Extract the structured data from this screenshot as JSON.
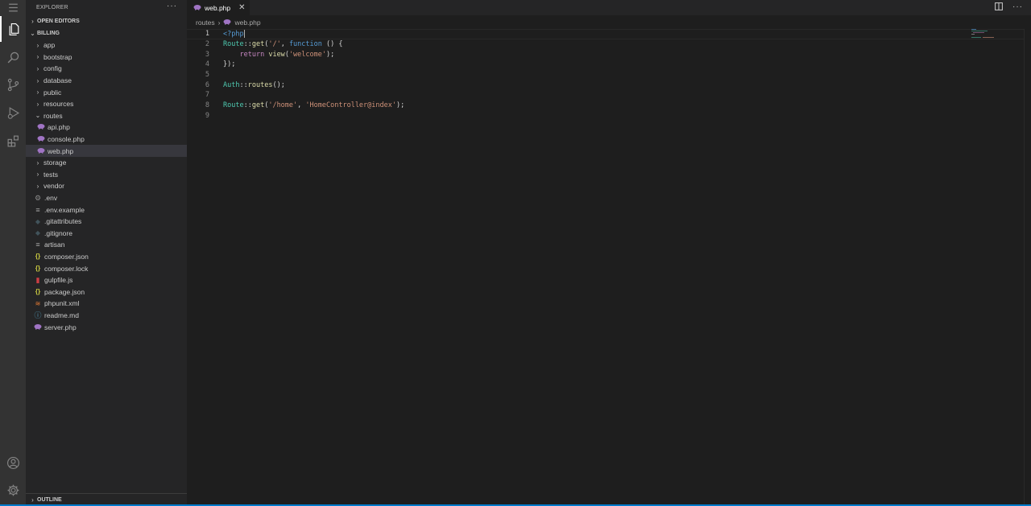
{
  "colors": {
    "php_icon": "#a074c4",
    "json_icon": "#cbcb41",
    "gulp_icon": "#cc3e44",
    "xml_icon": "#e37933",
    "info_icon": "#519aba",
    "git_icon": "#41535b",
    "accent": "#007acc"
  },
  "activity_bar": {
    "icons": [
      "menu-icon",
      "files-icon",
      "search-icon",
      "source-control-icon",
      "run-debug-icon",
      "extensions-icon",
      "account-icon",
      "settings-gear-icon"
    ]
  },
  "sidebar": {
    "title": "EXPLORER",
    "more": "···",
    "open_editors": "OPEN EDITORS",
    "project": "BILLING",
    "outline": "OUTLINE",
    "tree": [
      {
        "label": "app",
        "kind": "folder",
        "depth": 1
      },
      {
        "label": "bootstrap",
        "kind": "folder",
        "depth": 1
      },
      {
        "label": "config",
        "kind": "folder",
        "depth": 1
      },
      {
        "label": "database",
        "kind": "folder",
        "depth": 1
      },
      {
        "label": "public",
        "kind": "folder",
        "depth": 1
      },
      {
        "label": "resources",
        "kind": "folder",
        "depth": 1
      },
      {
        "label": "routes",
        "kind": "folder-open",
        "depth": 1
      },
      {
        "label": "api.php",
        "kind": "php",
        "depth": 2
      },
      {
        "label": "console.php",
        "kind": "php",
        "depth": 2
      },
      {
        "label": "web.php",
        "kind": "php",
        "depth": 2,
        "selected": true
      },
      {
        "label": "storage",
        "kind": "folder",
        "depth": 1
      },
      {
        "label": "tests",
        "kind": "folder",
        "depth": 1
      },
      {
        "label": "vendor",
        "kind": "folder",
        "depth": 1
      },
      {
        "label": ".env",
        "kind": "gear",
        "depth": 1
      },
      {
        "label": ".env.example",
        "kind": "lines",
        "depth": 1
      },
      {
        "label": ".gitattributes",
        "kind": "git",
        "depth": 1
      },
      {
        "label": ".gitignore",
        "kind": "git",
        "depth": 1
      },
      {
        "label": "artisan",
        "kind": "lines",
        "depth": 1
      },
      {
        "label": "composer.json",
        "kind": "json",
        "depth": 1
      },
      {
        "label": "composer.lock",
        "kind": "json",
        "depth": 1
      },
      {
        "label": "gulpfile.js",
        "kind": "gulp",
        "depth": 1
      },
      {
        "label": "package.json",
        "kind": "json",
        "depth": 1
      },
      {
        "label": "phpunit.xml",
        "kind": "xml",
        "depth": 1
      },
      {
        "label": "readme.md",
        "kind": "info",
        "depth": 1
      },
      {
        "label": "server.php",
        "kind": "php",
        "depth": 1
      }
    ]
  },
  "editor": {
    "tab_label": "web.php",
    "tab_close": "✕",
    "breadcrumb_folder": "routes",
    "breadcrumb_file": "web.php",
    "lines": [
      {
        "n": "1",
        "tokens": [
          [
            "t-tag",
            "<?php"
          ]
        ],
        "cursor": true
      },
      {
        "n": "2",
        "tokens": [
          [
            "t-type",
            "Route"
          ],
          [
            "t-punc",
            "::"
          ],
          [
            "t-fn",
            "get"
          ],
          [
            "t-punc",
            "("
          ],
          [
            "t-str",
            "'/'"
          ],
          [
            "t-punc",
            ", "
          ],
          [
            "t-kw",
            "function"
          ],
          [
            "t-punc",
            " () {"
          ]
        ]
      },
      {
        "n": "3",
        "tokens": [
          [
            "t-punc",
            "    "
          ],
          [
            "t-ctrl",
            "return"
          ],
          [
            "t-punc",
            " "
          ],
          [
            "t-fn",
            "view"
          ],
          [
            "t-punc",
            "("
          ],
          [
            "t-str",
            "'welcome'"
          ],
          [
            "t-punc",
            ");"
          ]
        ]
      },
      {
        "n": "4",
        "tokens": [
          [
            "t-punc",
            "});"
          ]
        ]
      },
      {
        "n": "5",
        "tokens": []
      },
      {
        "n": "6",
        "tokens": [
          [
            "t-type",
            "Auth"
          ],
          [
            "t-punc",
            "::"
          ],
          [
            "t-fn",
            "routes"
          ],
          [
            "t-punc",
            "();"
          ]
        ]
      },
      {
        "n": "7",
        "tokens": []
      },
      {
        "n": "8",
        "tokens": [
          [
            "t-type",
            "Route"
          ],
          [
            "t-punc",
            "::"
          ],
          [
            "t-fn",
            "get"
          ],
          [
            "t-punc",
            "("
          ],
          [
            "t-str",
            "'/home'"
          ],
          [
            "t-punc",
            ", "
          ],
          [
            "t-str",
            "'HomeController@index'"
          ],
          [
            "t-punc",
            ");"
          ]
        ]
      },
      {
        "n": "9",
        "tokens": []
      }
    ]
  }
}
